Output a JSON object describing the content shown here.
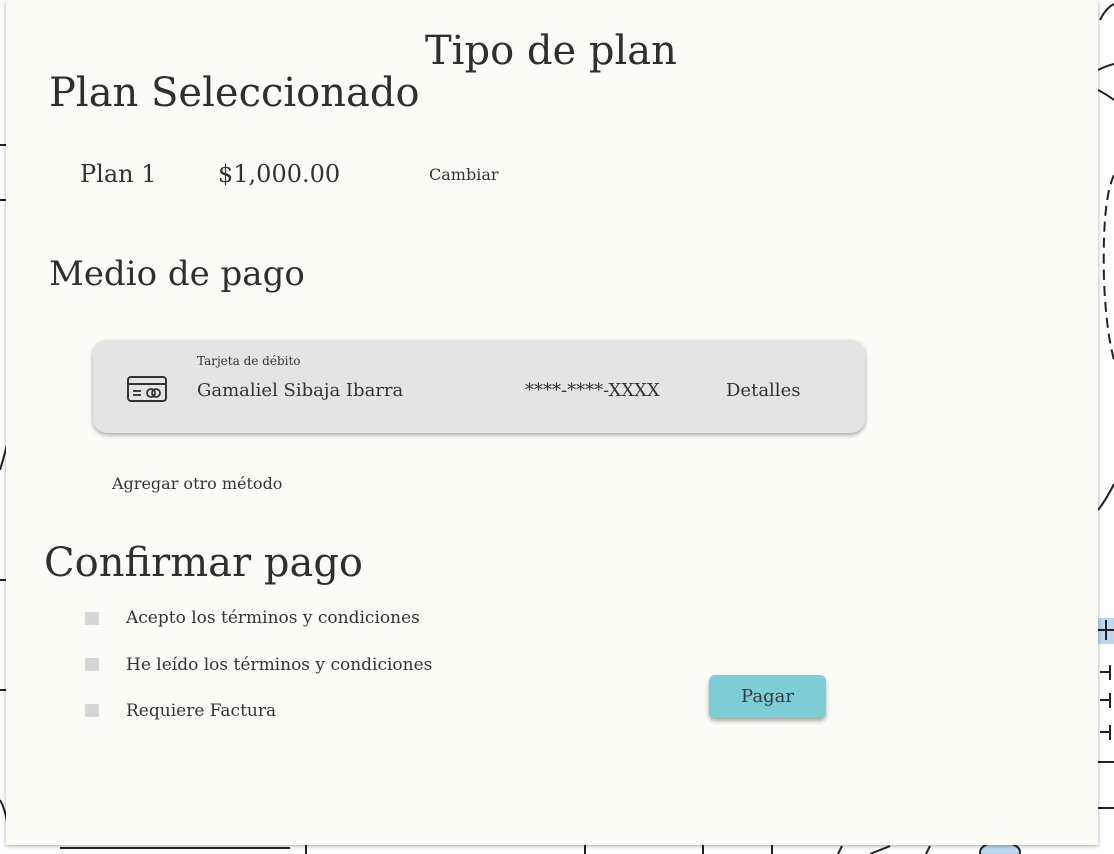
{
  "plan_section": {
    "title": "Tipo de plan",
    "heading": "Plan Seleccionado",
    "plan_name": "Plan 1",
    "plan_price": "$1,000.00",
    "change_label": "Cambiar"
  },
  "payment_section": {
    "heading": "Medio de pago",
    "method": {
      "type_label": "Tarjeta de débito",
      "holder_name": "Gamaliel Sibaja Ibarra",
      "masked_number": "****-****-XXXX",
      "details_label": "Detalles",
      "icon": "credit-card-icon"
    },
    "add_method_label": "Agregar otro método"
  },
  "confirm_section": {
    "heading": "Confirmar pago",
    "checkboxes": [
      {
        "label": "Acepto los términos y condiciones",
        "checked": false
      },
      {
        "label": "He leído los términos y condiciones",
        "checked": false
      },
      {
        "label": "Requiere Factura",
        "checked": false
      }
    ],
    "pay_label": "Pagar"
  },
  "colors": {
    "card_background": "#fdfdf8",
    "payment_card": "#e4e4e4",
    "pay_button": "#7ccdd5",
    "checkbox": "#d6d6d6",
    "sketch_accent": "#bcd8f0"
  }
}
